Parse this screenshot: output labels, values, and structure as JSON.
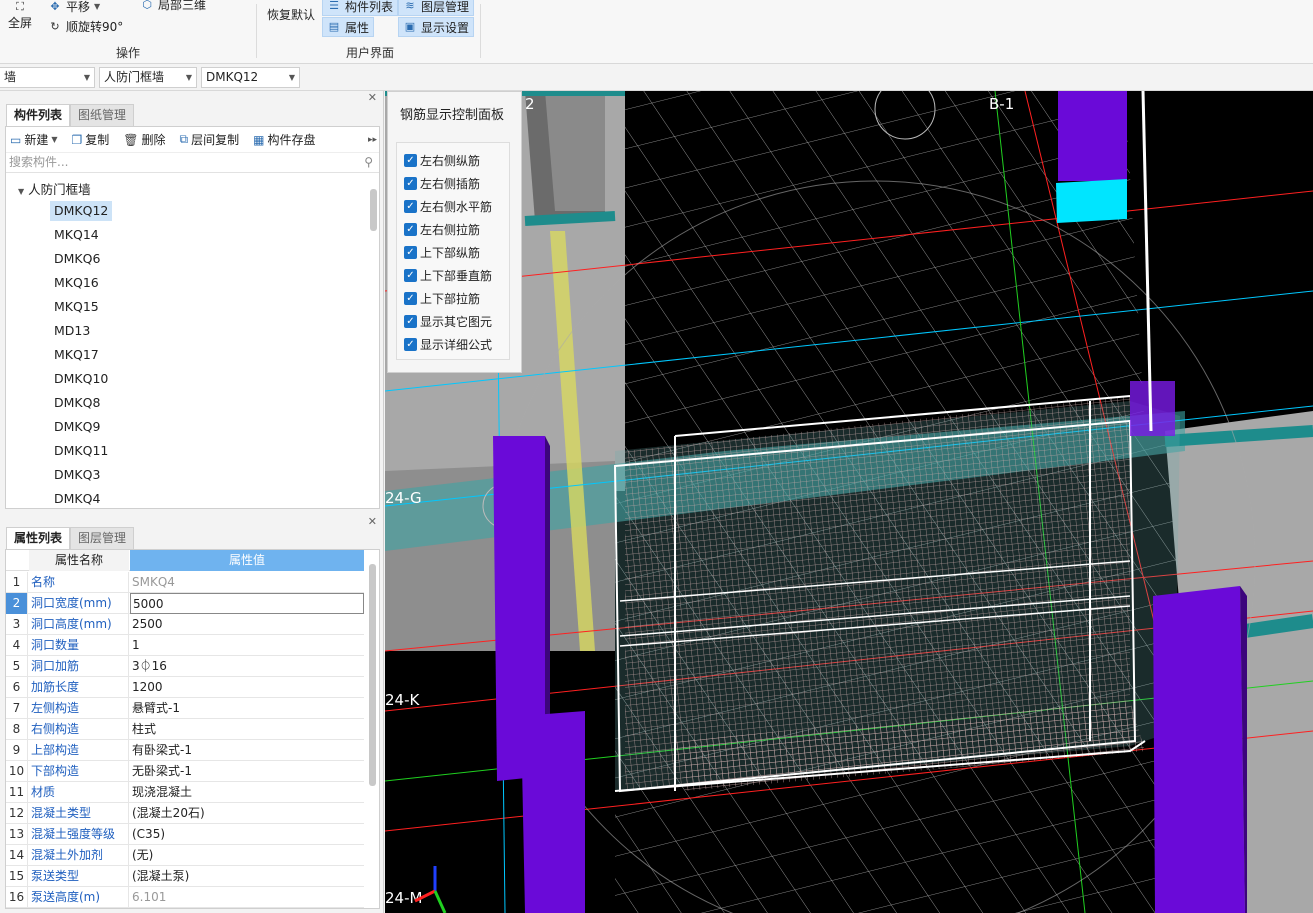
{
  "ribbon": {
    "fullscreen_label": "全屏",
    "pan_label": "平移",
    "rotate_label": "顺旋转90°",
    "local3d_label": "局部三维",
    "ops_group": "操作",
    "restore_label": "恢复默认",
    "component_list_label": "构件列表",
    "layer_mgmt_label": "图层管理",
    "properties_label": "属性",
    "display_settings_label": "显示设置",
    "ui_group": "用户界面"
  },
  "selector": {
    "type": "墙",
    "category": "人防门框墙",
    "component": "DMKQ12"
  },
  "component_panel": {
    "tabs": [
      "构件列表",
      "图纸管理"
    ],
    "toolbar": [
      "新建",
      "复制",
      "删除",
      "层间复制",
      "构件存盘"
    ],
    "search_placeholder": "搜索构件...",
    "root": "人防门框墙",
    "items": [
      "DMKQ12",
      "MKQ14",
      "DMKQ6",
      "MKQ16",
      "MKQ15",
      "MD13",
      "MKQ17",
      "DMKQ10",
      "DMKQ8",
      "DMKQ9",
      "DMKQ11",
      "DMKQ3",
      "DMKQ4"
    ]
  },
  "property_panel": {
    "tabs": [
      "属性列表",
      "图层管理"
    ],
    "header_name": "属性名称",
    "header_value": "属性值",
    "rows": [
      {
        "n": "1",
        "k": "名称",
        "v": "SMKQ4"
      },
      {
        "n": "2",
        "k": "洞口宽度(mm)",
        "v": "5000"
      },
      {
        "n": "3",
        "k": "洞口高度(mm)",
        "v": "2500"
      },
      {
        "n": "4",
        "k": "洞口数量",
        "v": "1"
      },
      {
        "n": "5",
        "k": "洞口加筋",
        "v": "3⏀16"
      },
      {
        "n": "6",
        "k": "加筋长度",
        "v": "1200"
      },
      {
        "n": "7",
        "k": "左侧构造",
        "v": "悬臂式-1"
      },
      {
        "n": "8",
        "k": "右侧构造",
        "v": "柱式"
      },
      {
        "n": "9",
        "k": "上部构造",
        "v": "有卧梁式-1"
      },
      {
        "n": "10",
        "k": "下部构造",
        "v": "无卧梁式-1"
      },
      {
        "n": "11",
        "k": "材质",
        "v": "现浇混凝土"
      },
      {
        "n": "12",
        "k": "混凝土类型",
        "v": "(混凝土20石)"
      },
      {
        "n": "13",
        "k": "混凝土强度等级",
        "v": "(C35)"
      },
      {
        "n": "14",
        "k": "混凝土外加剂",
        "v": "(无)"
      },
      {
        "n": "15",
        "k": "泵送类型",
        "v": "(混凝土泵)"
      },
      {
        "n": "16",
        "k": "泵送高度(m)",
        "v": "6.101"
      }
    ]
  },
  "rebar_panel": {
    "title": "钢筋显示控制面板",
    "options": [
      "左右侧纵筋",
      "左右侧插筋",
      "左右侧水平筋",
      "左右侧拉筋",
      "上下部纵筋",
      "上下部垂直筋",
      "上下部拉筋",
      "显示其它图元",
      "显示详细公式"
    ]
  },
  "viewport": {
    "axis_labels": [
      "2",
      "B-1",
      "24-G",
      "24-K",
      "24-M"
    ],
    "colors": {
      "wall": "#6a0ad8",
      "cyan": "#00e5ff",
      "rebar": "#c8a8a8",
      "teal": "#1e8c8c"
    }
  }
}
